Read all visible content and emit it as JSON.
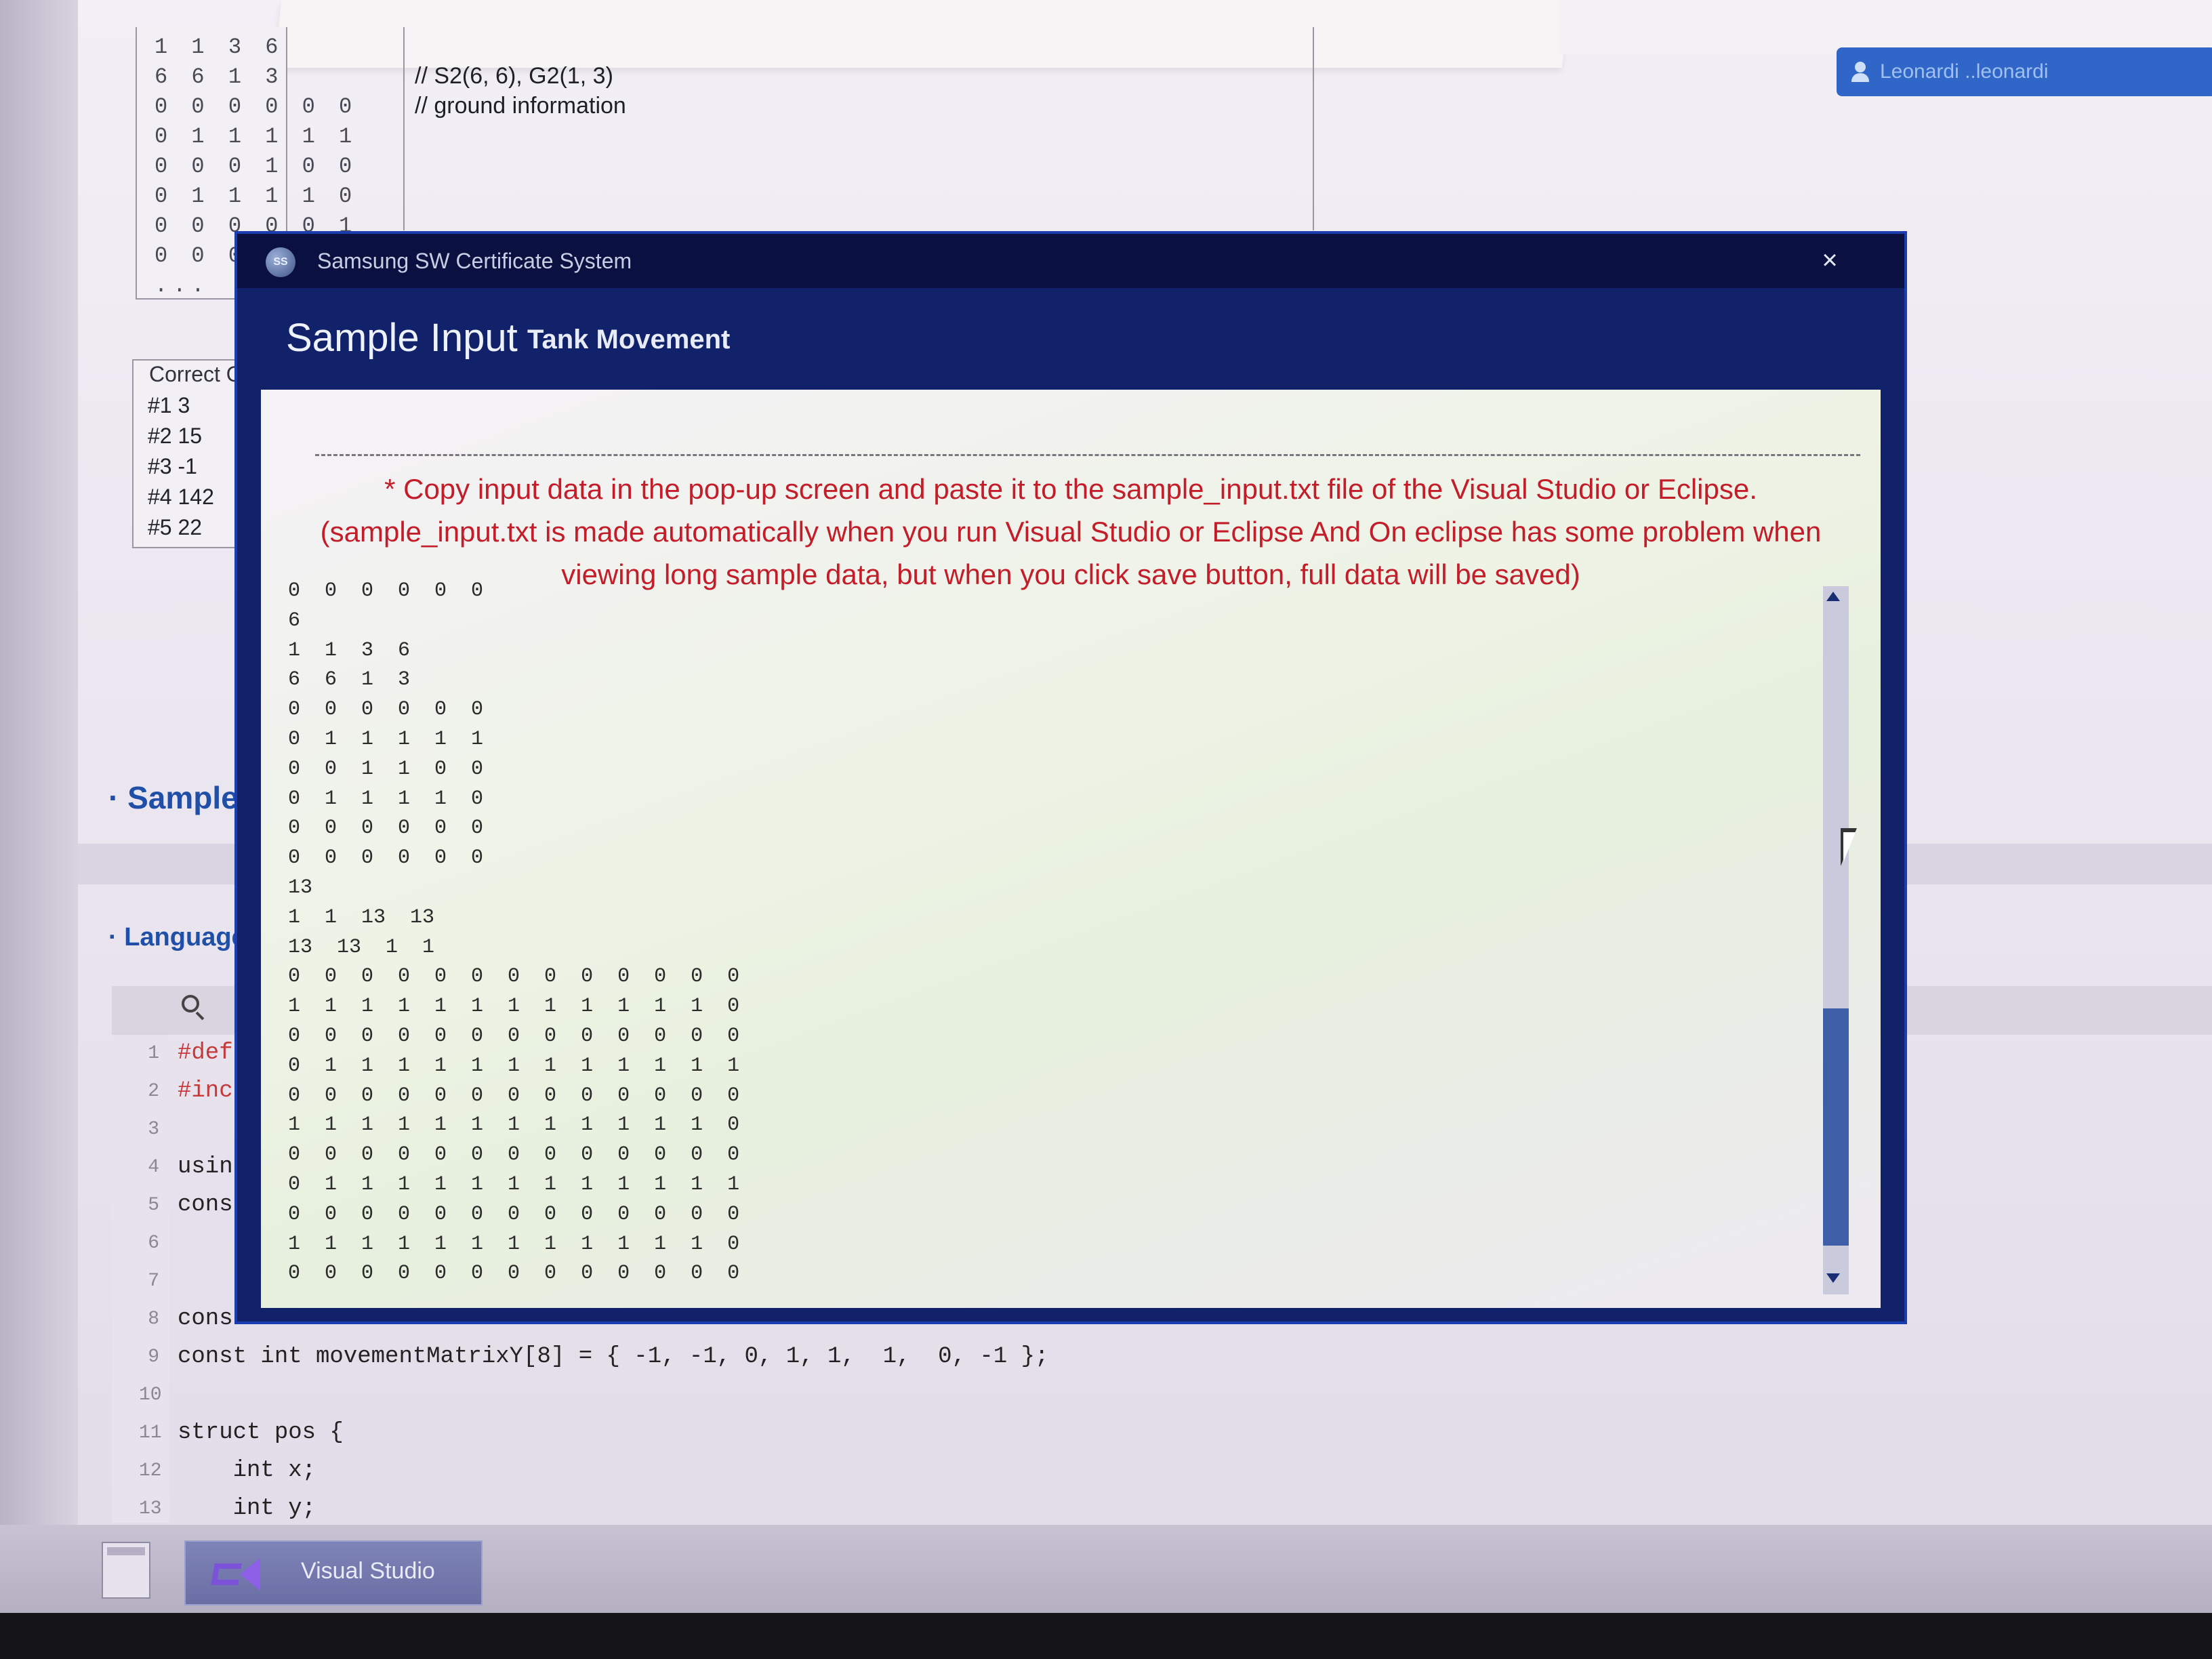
{
  "user": {
    "name": "Leonardi ..leonardi"
  },
  "problem": {
    "input_lines": [
      "1 1 3 6",
      "6 6 1 3",
      "0 0 0 0 0 0",
      "0 1 1 1 1 1",
      "0 0 0 1 0 0",
      "0 1 1 1 1 0",
      "0 0 0 0 0 1",
      "0 0 0 0 0",
      "..."
    ],
    "description_lines": [
      "// S2(6, 6), G2(1, 3)",
      "// ground information"
    ],
    "correct_header": "Correct O",
    "correct_rows": [
      "#1 3",
      "#2 15",
      "#3 -1",
      "#4 142",
      "#5 22"
    ],
    "sample_section": "· Sample I",
    "language_section": "· Language"
  },
  "editor": {
    "lines": [
      {
        "n": "1",
        "text": "#def",
        "color": "#c43a3a"
      },
      {
        "n": "2",
        "text": "#inc",
        "color": "#c43a3a"
      },
      {
        "n": "3",
        "text": "",
        "color": "#222"
      },
      {
        "n": "4",
        "text": "usin",
        "color": "#222"
      },
      {
        "n": "5",
        "text": "cons",
        "color": "#222"
      },
      {
        "n": "6",
        "text": "",
        "color": "#222"
      },
      {
        "n": "7",
        "text": "",
        "color": "#222"
      },
      {
        "n": "8",
        "text": "cons",
        "color": "#222"
      },
      {
        "n": "9",
        "text": "const int movementMatrixY[8] = { -1, -1, 0, 1, 1,  1,  0, -1 };",
        "color": "#222"
      },
      {
        "n": "10",
        "text": "",
        "color": "#222"
      },
      {
        "n": "11",
        "text": "struct pos {",
        "color": "#222"
      },
      {
        "n": "12",
        "text": "    int x;",
        "color": "#222"
      },
      {
        "n": "13",
        "text": "    int y;",
        "color": "#222"
      }
    ]
  },
  "modal": {
    "app_title": "Samsung SW Certificate System",
    "logo_text": "SS",
    "close_label": "×",
    "title": "Sample Input",
    "subtitle": "Tank Movement",
    "notice_lines": [
      "* Copy input data in the pop-up screen and paste it to the sample_input.txt file of the Visual Studio or Eclipse.",
      "(sample_input.txt is made automatically when you run Visual Studio or Eclipse And On eclipse has some problem when",
      "viewing long sample data, but when you click save button, full data will be saved)"
    ],
    "sample_lines": [
      "0 0 0 0 0 0",
      "6",
      "1 1 3 6",
      "6 6 1 3",
      "0 0 0 0 0 0",
      "0 1 1 1 1 1",
      "0 0 1 1 0 0",
      "0 1 1 1 1 0",
      "0 0 0 0 0 0",
      "0 0 0 0 0 0",
      "13",
      "1 1 13 13",
      "13 13 1 1",
      "0 0 0 0 0 0 0 0 0 0 0 0 0",
      "1 1 1 1 1 1 1 1 1 1 1 1 0",
      "0 0 0 0 0 0 0 0 0 0 0 0 0",
      "0 1 1 1 1 1 1 1 1 1 1 1 1",
      "0 0 0 0 0 0 0 0 0 0 0 0 0",
      "1 1 1 1 1 1 1 1 1 1 1 1 0",
      "0 0 0 0 0 0 0 0 0 0 0 0 0",
      "0 1 1 1 1 1 1 1 1 1 1 1 1",
      "0 0 0 0 0 0 0 0 0 0 0 0 0",
      "1 1 1 1 1 1 1 1 1 1 1 1 0",
      "0 0 0 0 0 0 0 0 0 0 0 0 0"
    ],
    "scroll_position": 0.55
  },
  "taskbar": {
    "app_label": "Visual Studio"
  },
  "colors": {
    "modal_header": "#12226a",
    "notice_red": "#c41d2a",
    "link_blue": "#1f4fa6"
  }
}
